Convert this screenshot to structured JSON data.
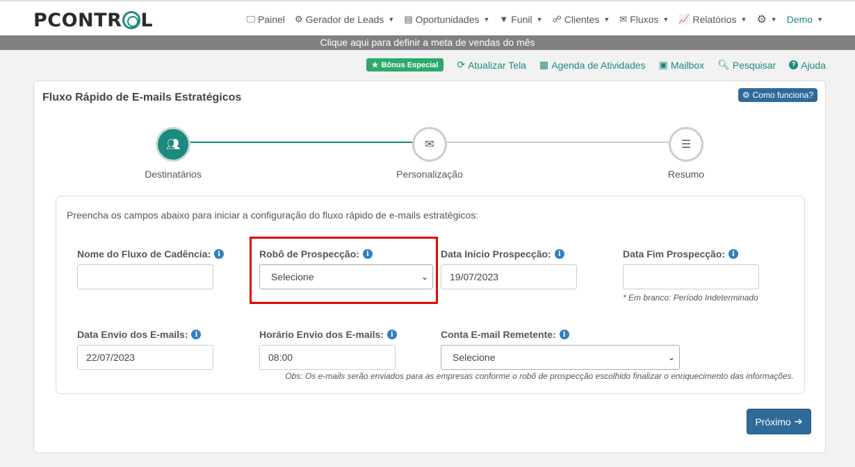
{
  "header": {
    "logo_text_a": "PCONTR",
    "logo_text_b": "L",
    "nav": [
      {
        "label": "Painel",
        "icon": "monitor-icon"
      },
      {
        "label": "Gerador de Leads",
        "icon": "robot-icon"
      },
      {
        "label": "Oportunidades",
        "icon": "clipboard-icon"
      },
      {
        "label": "Funil",
        "icon": "filter-icon"
      },
      {
        "label": "Clientes",
        "icon": "handshake-icon"
      },
      {
        "label": "Fluxos",
        "icon": "envelope-icon"
      },
      {
        "label": "Relatórios",
        "icon": "chart-line-icon"
      },
      {
        "label": "",
        "icon": "gear-icon"
      },
      {
        "label": "Demo",
        "icon": ""
      }
    ]
  },
  "goal_bar": "Clique aqui para definir a meta de vendas do mês",
  "toolbar": {
    "bonus": "Bônus Especial",
    "refresh": "Atualizar Tela",
    "agenda": "Agenda de Atividades",
    "mailbox": "Mailbox",
    "search": "Pesquisar",
    "help": "Ajuda"
  },
  "card": {
    "title": "Fluxo Rápido de E-mails Estratégicos",
    "howto": "Como funciona?",
    "steps": [
      "Destinatários",
      "Personalização",
      "Resumo"
    ],
    "intro": "Preencha os campos abaixo para iniciar a configuração do fluxo rápido de e-mails estratégicos:",
    "fields": {
      "name": {
        "label": "Nome do Fluxo de Cadência:",
        "value": ""
      },
      "robot": {
        "label": "Robô de Prospecção:",
        "value": "Selecione"
      },
      "start": {
        "label": "Data Início Prospecção:",
        "value": "19/07/2023"
      },
      "end": {
        "label": "Data Fim Prospecção:",
        "value": "",
        "hint": "* Em branco: Período Indeterminado"
      },
      "send_date": {
        "label": "Data Envio dos E-mails:",
        "value": "22/07/2023"
      },
      "send_time": {
        "label": "Horário Envio dos E-mails:",
        "value": "08:00"
      },
      "sender": {
        "label": "Conta E-mail Remetente:",
        "value": "Selecione"
      }
    },
    "obs": "Obs: Os e-mails serão enviados para as empresas conforme o robô de prospecção escolhido finalizar o enriquecimento das informações.",
    "next": "Próximo"
  },
  "colors": {
    "accent": "#1c8a7e",
    "primary_button": "#2f6b9a",
    "highlight": "#e00000",
    "bonus": "#2baa6a"
  }
}
